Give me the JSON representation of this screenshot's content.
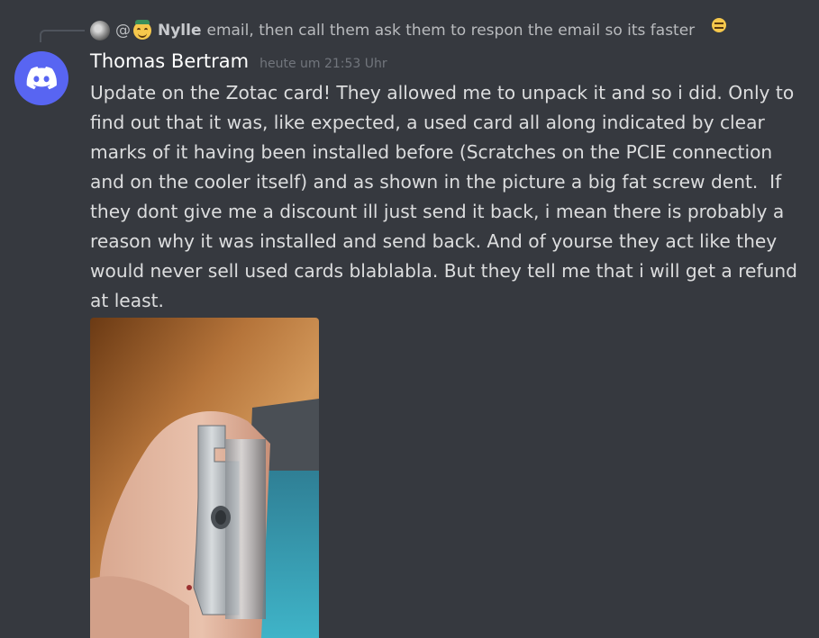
{
  "reply": {
    "mention_prefix": "@",
    "author": "Nylle",
    "text": "email, then call them ask them to respon the email so its faster",
    "author_avatar_icon": "gray-circle-avatar",
    "author_emoji_icon": "smiling-face-with-hat-emoji",
    "trailing_emoji_icon": "grinning-face-emoji"
  },
  "message": {
    "author": "Thomas Bertram",
    "timestamp": "heute um 21:53 Uhr",
    "avatar_icon": "discord-logo-icon",
    "avatar_color": "#5865f2",
    "text": "Update on the Zotac card! They allowed me to unpack it and so i did. Only to find out that it was, like expected, a used card all along indicated by clear marks of it having been installed before (Scratches on the PCIE connection and on the cooler itself) and as shown in the picture a big fat screw dent.  If they dont give me a discount ill just send it back, i mean there is probably a reason why it was installed and send back. And of yourse they act like they would never sell used cards blablabla. But they tell me that i will get a refund at least.",
    "attachment": {
      "type": "photo",
      "subject": "hand holding graphics card bracket with screw dent"
    }
  },
  "theme": {
    "background": "#36393f",
    "text": "#dcddde",
    "username": "#ffffff",
    "timestamp": "#72767d",
    "reply_text": "#b9bbbe",
    "blurple": "#5865f2"
  }
}
